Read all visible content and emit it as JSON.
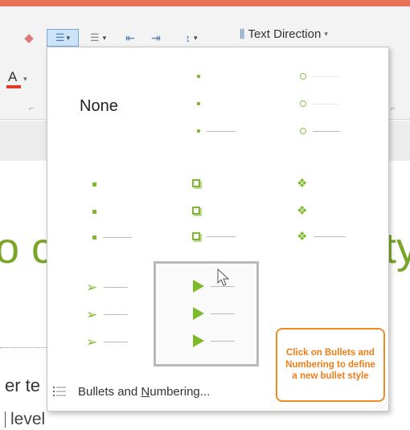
{
  "ribbon": {
    "text_direction_label": "Text Direction",
    "font_color_glyph": "A",
    "bullets_glyph": "☰",
    "numbering_glyph": "☰",
    "line_spacing_glyph": "↕",
    "launcher_glyph": "⌐"
  },
  "slide": {
    "title_fragment_left": "o c",
    "title_fragment_right": "ty",
    "body_fragment": "er te",
    "body_level_fragment": "level"
  },
  "bullets_menu": {
    "none_label": "None",
    "footer_label_prefix": "Bullets and ",
    "footer_label_underlined": "N",
    "footer_label_suffix": "umbering..."
  },
  "callout": {
    "text": "Click on Bullets and Numbering to define a new bullet style",
    "color": "#f08a24"
  },
  "colors": {
    "bullet_green": "#7fba2e",
    "accent_title": "#7aa52a"
  }
}
